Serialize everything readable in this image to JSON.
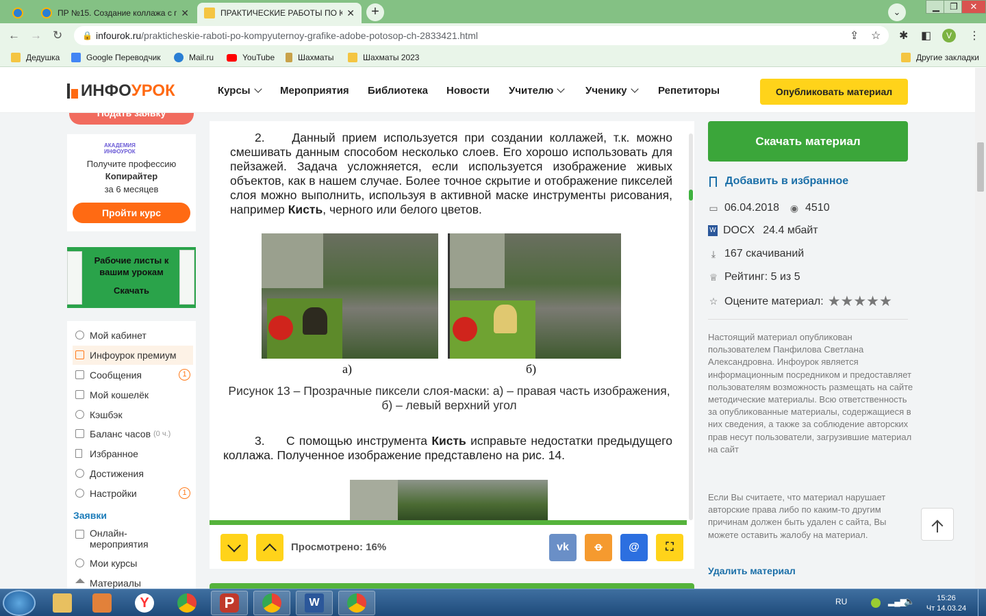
{
  "browser": {
    "tabs": [
      {
        "title": "",
        "favicon_color": "#2a7fd4"
      },
      {
        "title": "ПР №15. Создание коллажа с п",
        "favicon_color": "#2a7fd4"
      },
      {
        "title": "ПРАКТИЧЕСКИЕ РАБОТЫ ПО КО",
        "favicon_color": "#f4c542"
      }
    ],
    "new_tab": "+",
    "url_domain": "infourok.ru",
    "url_path": "/prakticheskie-raboti-po-kompyuternoy-grafike-adobe-potosop-ch-2833421.html",
    "profile_initial": "V",
    "bookmarks": [
      {
        "label": "Дедушка",
        "icon": "folder-icon"
      },
      {
        "label": "Google Переводчик",
        "icon": "google-translate-icon"
      },
      {
        "label": "Mail.ru",
        "icon": "mailru-icon"
      },
      {
        "label": "YouTube",
        "icon": "youtube-icon"
      },
      {
        "label": "Шахматы",
        "icon": "chess-icon"
      },
      {
        "label": "Шахматы 2023",
        "icon": "folder-icon"
      }
    ],
    "other_bookmarks": "Другие закладки"
  },
  "site": {
    "logo_part1": "ИНФО",
    "logo_part2": "УРОК",
    "menu": [
      "Курсы",
      "Мероприятия",
      "Библиотека",
      "Новости",
      "Учителю",
      "Ученику",
      "Репетиторы"
    ],
    "publish_button": "Опубликовать материал"
  },
  "sidebar": {
    "top_button": "Подать заявку",
    "academy_line1": "АКАДЕМИЯ",
    "academy_line2": "ИНФОУРОК",
    "promo_line1": "Получите профессию",
    "promo_line2": "Копирайтер",
    "promo_line3": "за 6 месяцев",
    "promo_button": "Пройти курс",
    "worksheets_text": "Рабочие листы к вашим урокам",
    "worksheets_button": "Скачать",
    "menu_items": [
      {
        "label": "Мой кабинет",
        "badge": "",
        "sub": ""
      },
      {
        "label": "Инфоурок премиум",
        "badge": "",
        "sub": ""
      },
      {
        "label": "Сообщения",
        "badge": "1",
        "sub": ""
      },
      {
        "label": "Мой кошелёк",
        "badge": "",
        "sub": ""
      },
      {
        "label": "Кэшбэк",
        "badge": "",
        "sub": ""
      },
      {
        "label": "Баланс часов",
        "badge": "",
        "sub": "(0 ч.)"
      },
      {
        "label": "Избранное",
        "badge": "",
        "sub": ""
      },
      {
        "label": "Достижения",
        "badge": "",
        "sub": ""
      },
      {
        "label": "Настройки",
        "badge": "1",
        "sub": ""
      }
    ],
    "section_title": "Заявки",
    "section_items": [
      "Онлайн-\nмероприятия",
      "Мои курсы",
      "Материалы"
    ]
  },
  "document": {
    "para2_num": "2.",
    "para2_text": "Данный прием используется при создании коллажей, т.к. можно смешивать данным способом несколько слоев. Его хорошо использовать для пейзажей. Задача усложняется, если используется изображение живых объектов, как в нашем случае. Более точное скрытие и отображение пикселей слоя можно выполнить, используя в активной маске инструменты рисования, например ",
    "para2_bold": "Кисть",
    "para2_end": ", черного или белого цветов.",
    "label_a": "а)",
    "label_b": "б)",
    "figure_caption_line1": "Рисунок 13 – Прозрачные пиксели слоя-маски: а) – правая часть изображения,",
    "figure_caption_line2": "б) – левый верхний угол",
    "para3_num": "3.",
    "para3_start": "С помощью инструмента ",
    "para3_bold": "Кисть",
    "para3_end": " исправьте недостатки предыдущего коллажа. Полученное изображение представлено на рис. 14."
  },
  "viewer": {
    "viewed_label": "Просмотрено: 16%",
    "viewed_progress": 0.16,
    "share": [
      {
        "label": "vk",
        "color": "#6a8fc7"
      },
      {
        "label": "ok",
        "color": "#f59a2f"
      },
      {
        "label": "@",
        "color": "#2c6fe0"
      },
      {
        "label": "fullscreen",
        "color": "#ffd31a"
      }
    ]
  },
  "material": {
    "download_button": "Скачать материал",
    "favorite": "Добавить в избранное",
    "date": "06.04.2018",
    "views": "4510",
    "format": "DOCX",
    "size": "24.4 мбайт",
    "downloads": "167 скачиваний",
    "rating": "Рейтинг: 5 из 5",
    "rate_label": "Оцените материал:",
    "stars": "★★★★★",
    "disclaimer": "Настоящий материал опубликован пользователем Панфилова Светлана Александровна. Инфоурок является информационным посредником и предоставляет пользователям возможность размещать на сайте методические материалы. Всю ответственность за опубликованные материалы, содержащиеся в них сведения, а также за соблюдение авторских прав несут пользователи, загрузившие материал на сайт",
    "disclaimer2": "Если Вы считаете, что материал нарушает авторские права либо по каким-то другим причинам должен быть удален с сайта, Вы можете оставить жалобу на материал.",
    "delete_link": "Удалить материал"
  },
  "taskbar": {
    "lang": "RU",
    "time": "15:26",
    "date": "Чт 14.03.24"
  },
  "colors": {
    "brand_orange": "#ff6a13",
    "brand_green": "#3ba63a",
    "publish_yellow": "#ffd31a",
    "link_blue": "#1b6fa8"
  }
}
